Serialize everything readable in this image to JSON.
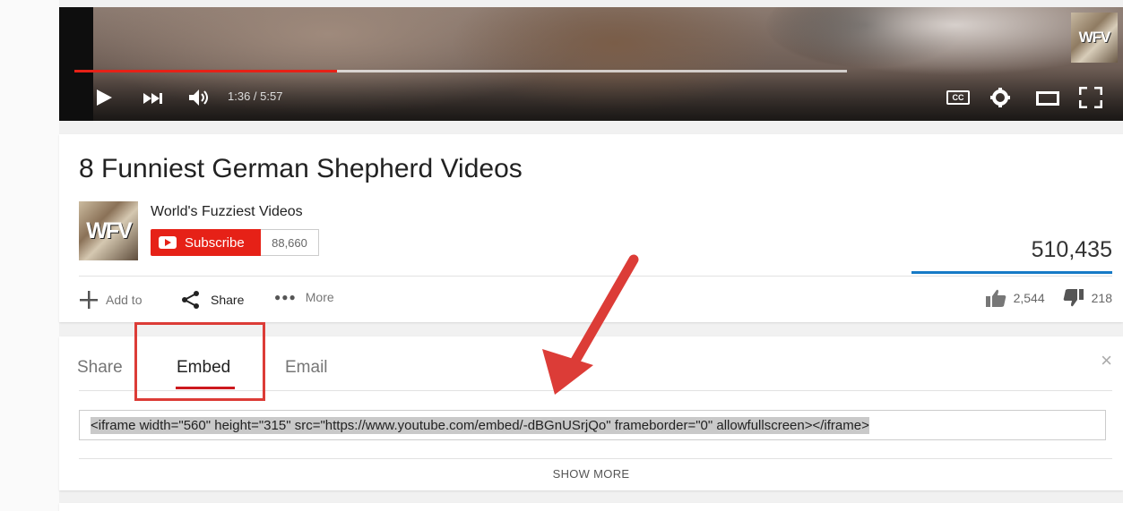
{
  "player": {
    "time": "1:36 / 5:57",
    "progress_played": 0.34,
    "progress_buffered": 1.0,
    "watermark": "WFV",
    "icons": [
      "play-icon",
      "next-icon",
      "volume-icon",
      "captions-icon",
      "settings-icon",
      "theater-mode-icon",
      "fullscreen-icon"
    ],
    "cc_label": "CC"
  },
  "video": {
    "title": "8 Funniest German Shepherd Videos",
    "channel": "World's Fuzziest Videos",
    "channel_avatar_text": "WFV",
    "subscribe_label": "Subscribe",
    "subscriber_count": "88,660",
    "views": "510,435",
    "likes": "2,544",
    "dislikes": "218"
  },
  "actions": {
    "add_to": "Add to",
    "share": "Share",
    "more": "More"
  },
  "share_panel": {
    "tabs": [
      {
        "label": "Share",
        "active": false
      },
      {
        "label": "Embed",
        "active": true
      },
      {
        "label": "Email",
        "active": false
      }
    ],
    "close_symbol": "×",
    "embed_code": "<iframe width=\"560\" height=\"315\" src=\"https://www.youtube.com/embed/-dBGnUSrjQo\" frameborder=\"0\" allowfullscreen></iframe>",
    "show_more": "SHOW MORE"
  },
  "colors": {
    "youtube_red": "#e62117",
    "annotation_red": "#dc3c37",
    "view_bar_blue": "#167ac6"
  }
}
